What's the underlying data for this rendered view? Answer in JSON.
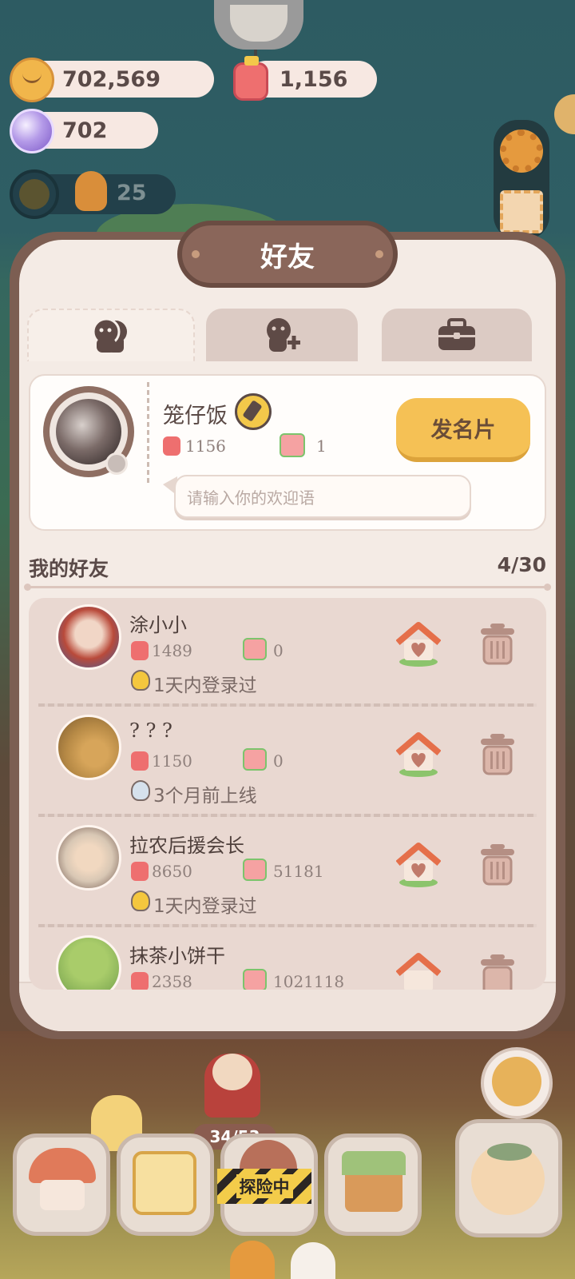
{
  "currencies": {
    "cookie": "702,569",
    "jam": "1,156",
    "gem": "702",
    "energy": "25"
  },
  "panel": {
    "title": "好友",
    "tabs": [
      {
        "icon": "friends-icon",
        "active": true
      },
      {
        "icon": "add-friend-icon",
        "active": false
      },
      {
        "icon": "briefcase-icon",
        "active": false
      }
    ]
  },
  "profile": {
    "name": "笼仔饭",
    "jam_count": "1156",
    "gift_count": "1",
    "send_card_label": "发名片",
    "greeting_placeholder": "请输入你的欢迎语"
  },
  "friends_section": {
    "title": "我的好友",
    "count": "4/30"
  },
  "friends": [
    {
      "name": "涂小小",
      "jam": "1489",
      "gift": "0",
      "status": "1天内登录过",
      "status_color": "#f4c73e",
      "avatar_color": "#b94a3a"
    },
    {
      "name": "? ? ?",
      "jam": "1150",
      "gift": "0",
      "status": "3个月前上线",
      "status_color": "#d6e1ec",
      "avatar_color": "#b78a46"
    },
    {
      "name": "拉农后援会长",
      "jam": "8650",
      "gift": "51181",
      "status": "1天内登录过",
      "status_color": "#f4c73e",
      "avatar_color": "#d8c7b4"
    },
    {
      "name": "抹茶小饼干",
      "jam": "2358",
      "gift": "1021118",
      "status": "",
      "status_color": "#f4c73e",
      "avatar_color": "#8cb45a"
    }
  ],
  "bottom": {
    "explore_label": "探险中",
    "progress": "34/53"
  }
}
